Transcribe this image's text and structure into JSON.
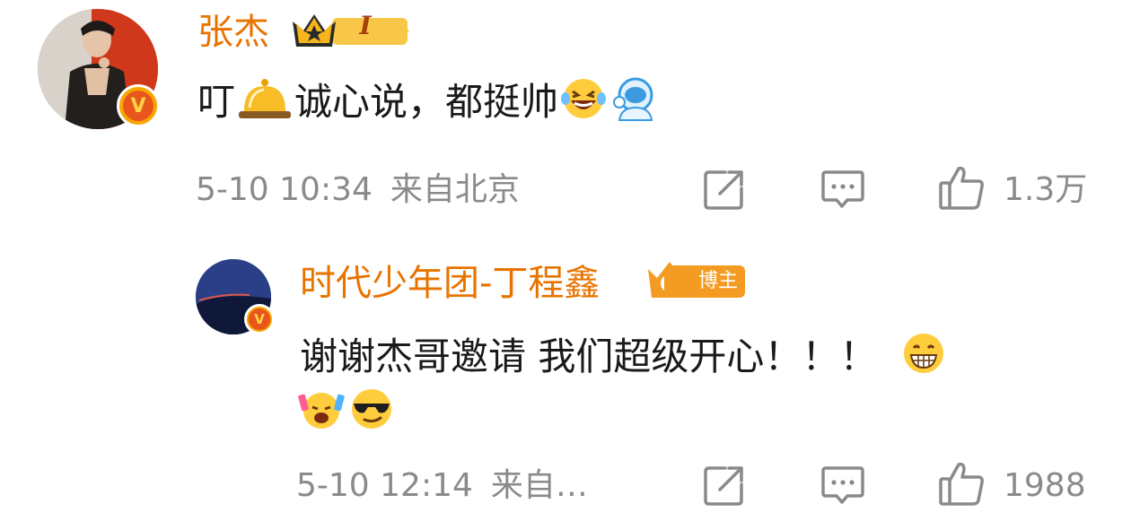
{
  "comment": {
    "username": "张杰",
    "level_badge": "I",
    "text_part1": "叮",
    "text_part2": "诚心说，都挺帅",
    "date": "5-10 10:34",
    "location": "来自北京",
    "likes": "1.3万",
    "icons": [
      "share-icon",
      "comment-icon",
      "like-icon",
      "bell-emoji",
      "laughing-tears-emoji",
      "astronaut-emoji",
      "crown-icon"
    ]
  },
  "reply": {
    "username": "时代少年团-丁程鑫",
    "badge_label": "博主",
    "text_line1": "谢谢杰哥邀请 我们超级开心！！！",
    "date": "5-10 12:14",
    "location": "来自…",
    "likes": "1988",
    "icons": [
      "share-icon",
      "comment-icon",
      "like-icon",
      "grin-emoji",
      "cheering-emoji",
      "cool-sunglasses-emoji"
    ]
  },
  "colors": {
    "username": "#e87400",
    "meta": "#8a8a8a",
    "text": "#1a1a1a",
    "verify_badge": "#f7a600"
  }
}
